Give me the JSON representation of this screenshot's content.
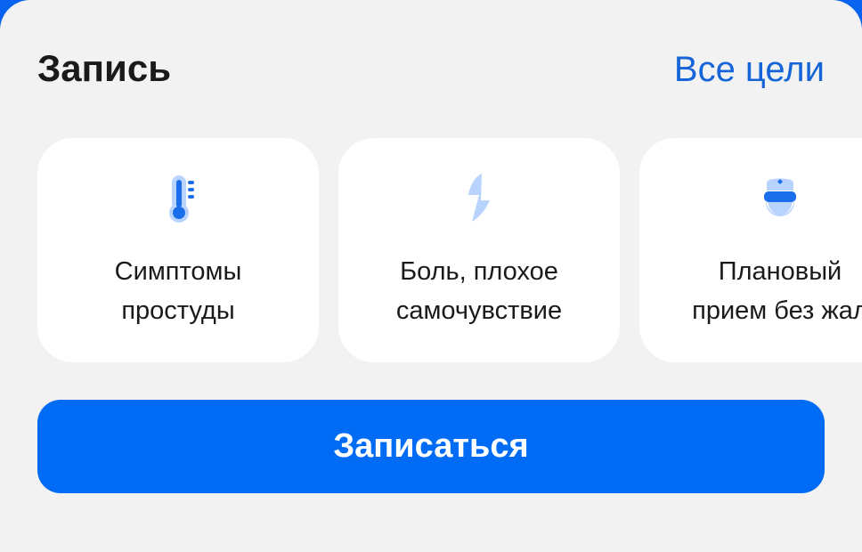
{
  "header": {
    "title": "Запись",
    "all_goals_link": "Все цели"
  },
  "cards": [
    {
      "icon": "thermometer-icon",
      "label": "Симптомы\nпростуды"
    },
    {
      "icon": "lightning-icon",
      "label": "Боль, плохое\nсамочувствие"
    },
    {
      "icon": "doctor-icon",
      "label": "Плановый\nприем без жал"
    }
  ],
  "primary_button": {
    "label": "Записаться"
  },
  "colors": {
    "accent": "#006cf5",
    "link": "#1565d8",
    "icon_primary": "#1b6ee9",
    "icon_light": "#b9d3ff"
  }
}
